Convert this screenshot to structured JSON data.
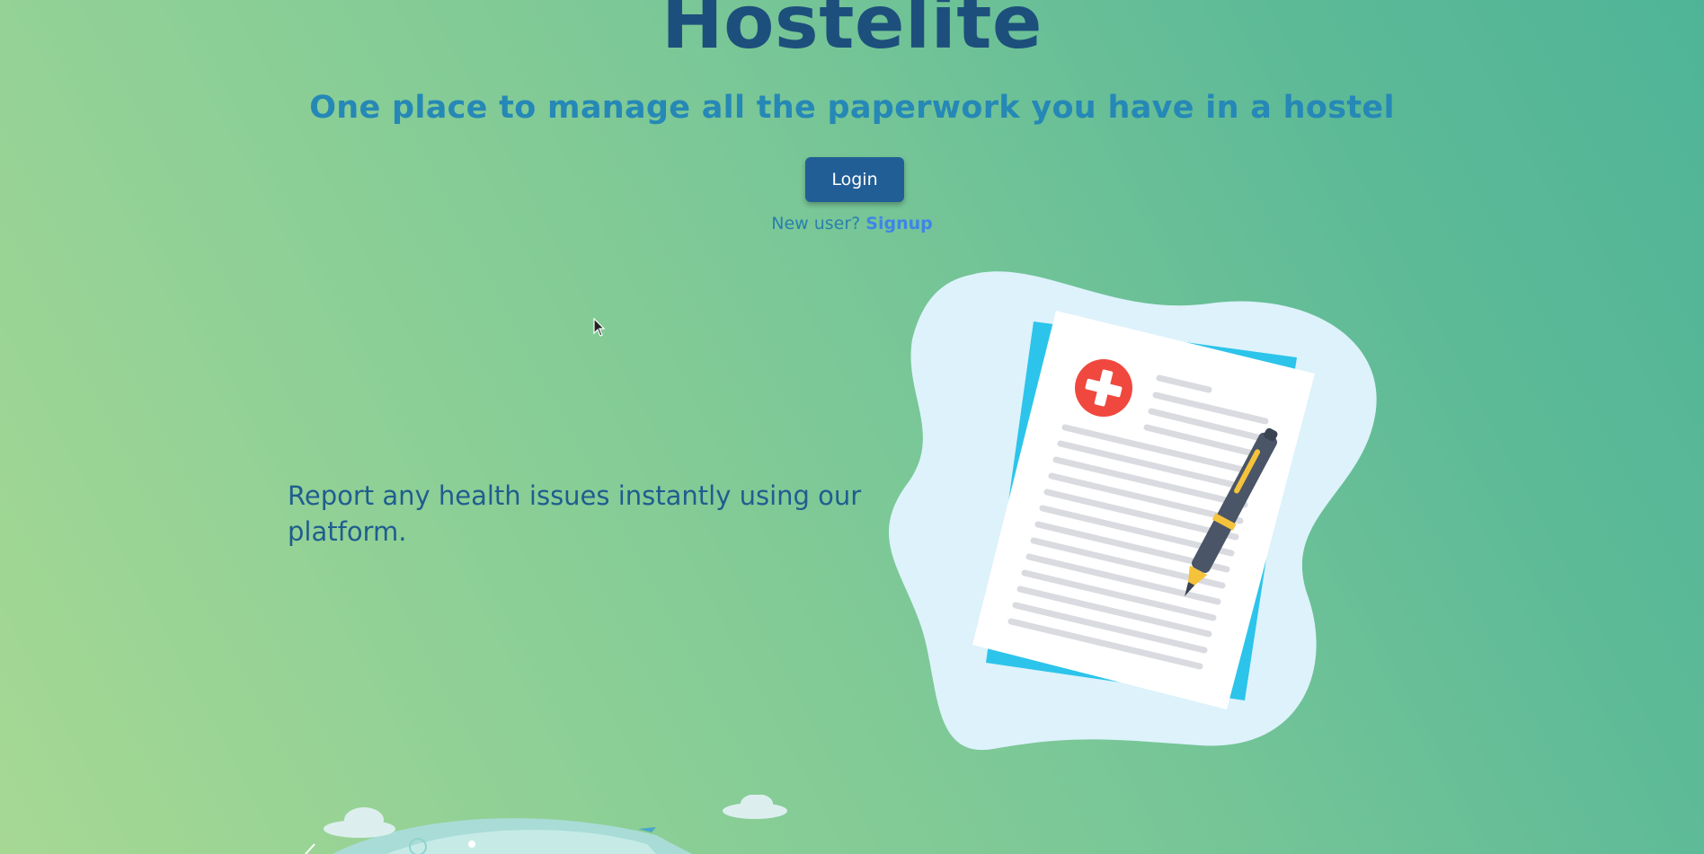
{
  "hero": {
    "title": "Hostelite",
    "subtitle": "One place to manage all the paperwork you have in a hostel"
  },
  "auth": {
    "login_label": "Login",
    "new_user_text": "New user?",
    "signup_label": "Signup"
  },
  "feature": {
    "description": "Report any health issues instantly using our platform.",
    "illustration_icon": "medical-report-with-pen-icon"
  },
  "colors": {
    "title": "#1d4f7c",
    "subtitle": "#2588b6",
    "button": "#215e96",
    "link": "#3f84e8",
    "accent_cross": "#f0483e"
  }
}
